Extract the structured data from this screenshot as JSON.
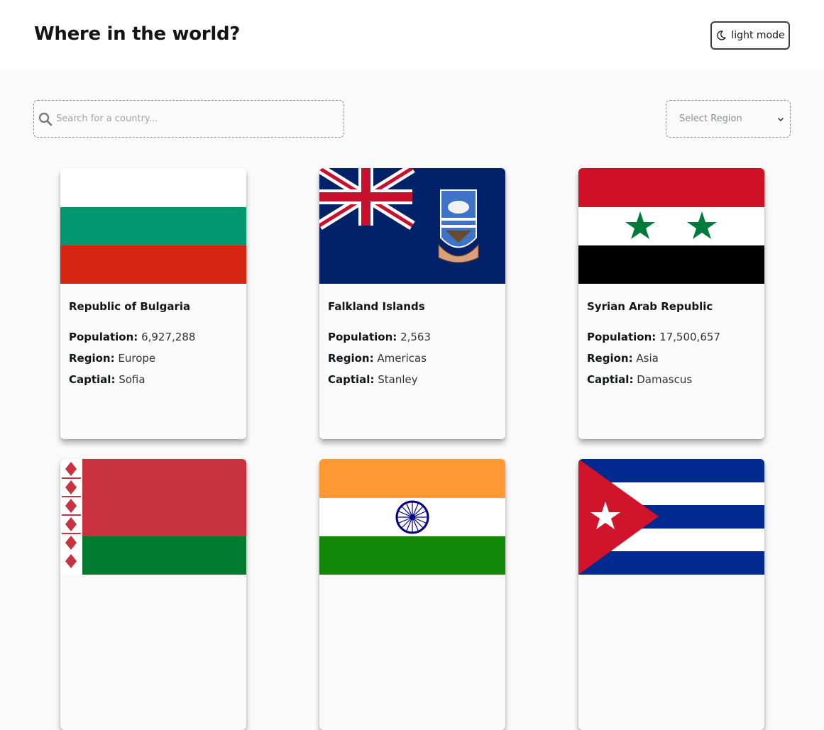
{
  "header": {
    "title": "Where in the world?",
    "mode_label": "light mode"
  },
  "search": {
    "placeholder": "Search for a country..."
  },
  "filter": {
    "label": "Select Region"
  },
  "labels": {
    "population": "Population:",
    "region": "Region:",
    "capital": "Captial:"
  },
  "countries": [
    {
      "name": "Republic of Bulgaria",
      "population": "6,927,288",
      "region": "Europe",
      "capital": "Sofia"
    },
    {
      "name": "Falkland Islands",
      "population": "2,563",
      "region": "Americas",
      "capital": "Stanley"
    },
    {
      "name": "Syrian Arab Republic",
      "population": "17,500,657",
      "region": "Asia",
      "capital": "Damascus"
    }
  ],
  "colors": {
    "background": "#fafafa",
    "header_bg": "#ffffff",
    "text": "#111517"
  }
}
